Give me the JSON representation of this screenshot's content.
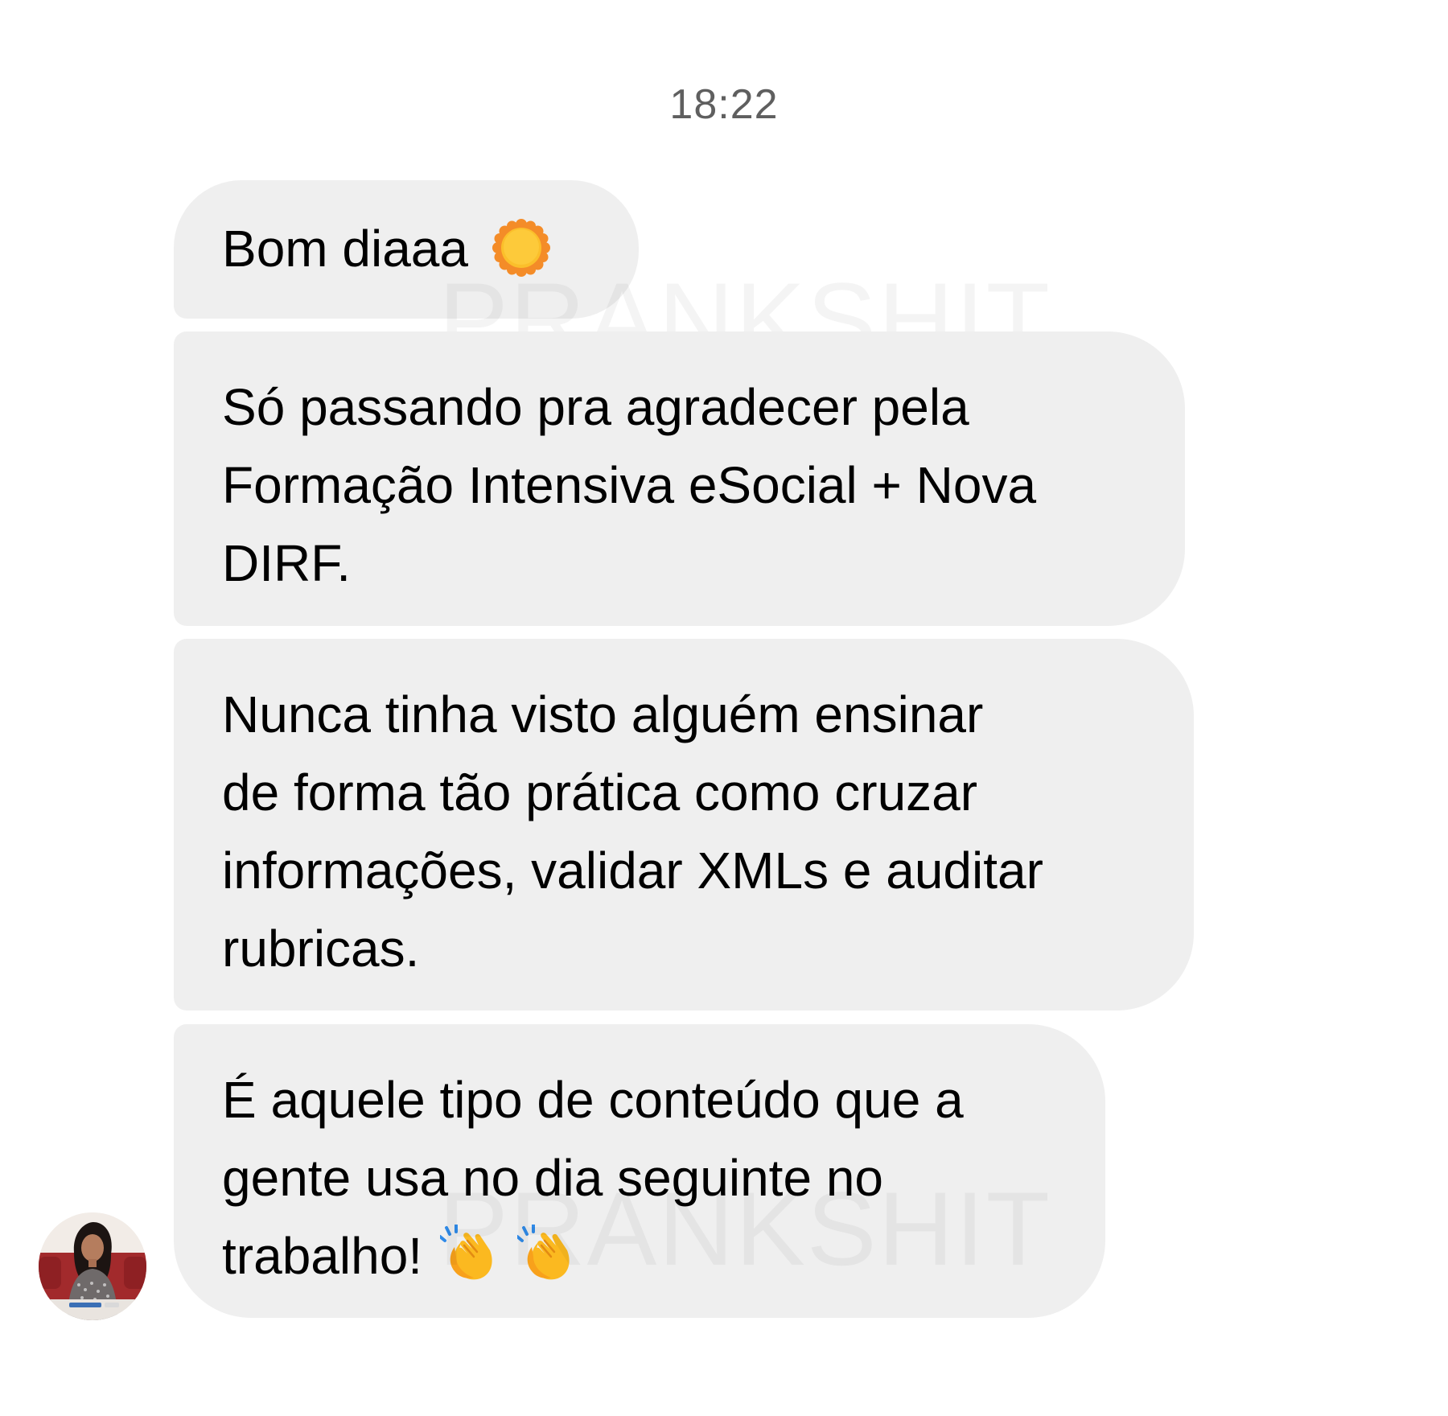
{
  "chat": {
    "timestamp": "18:22",
    "messages": [
      {
        "text": "Bom diaaa",
        "emoji": [
          "sun-icon"
        ]
      },
      {
        "text": "Só passando pra agradecer pela\nFormação Intensiva eSocial + Nova\nDIRF.",
        "emoji": []
      },
      {
        "text": "Nunca tinha visto alguém ensinar\nde forma tão prática como cruzar\ninformações, validar XMLs e auditar\nrubricas.",
        "emoji": []
      },
      {
        "text": "É aquele tipo de conteúdo que a\ngente usa no dia seguinte no\ntrabalho!",
        "emoji": [
          "clapping-hands-icon",
          "clapping-hands-icon"
        ]
      }
    ],
    "watermark": "PRANKSHIT",
    "bubble_color": "#efefef",
    "timestamp_color": "#5f5f5f"
  }
}
